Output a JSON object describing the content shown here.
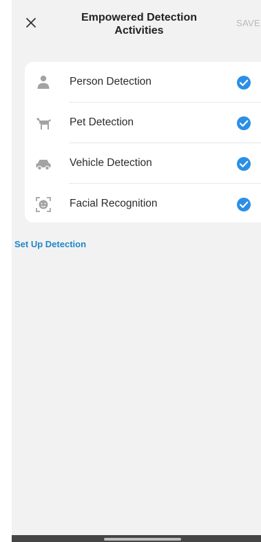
{
  "header": {
    "title": "Empowered Detection Activities",
    "save_label": "SAVE"
  },
  "detections": [
    {
      "label": "Person Detection",
      "icon": "person-icon",
      "checked": true
    },
    {
      "label": "Pet Detection",
      "icon": "pet-icon",
      "checked": true
    },
    {
      "label": "Vehicle Detection",
      "icon": "vehicle-icon",
      "checked": true
    },
    {
      "label": "Facial Recognition",
      "icon": "face-icon",
      "checked": true
    }
  ],
  "setup_link": "Set Up Detection",
  "colors": {
    "accent": "#1e88c8",
    "check": "#2b8fe6",
    "icon": "#a3a3a3"
  }
}
